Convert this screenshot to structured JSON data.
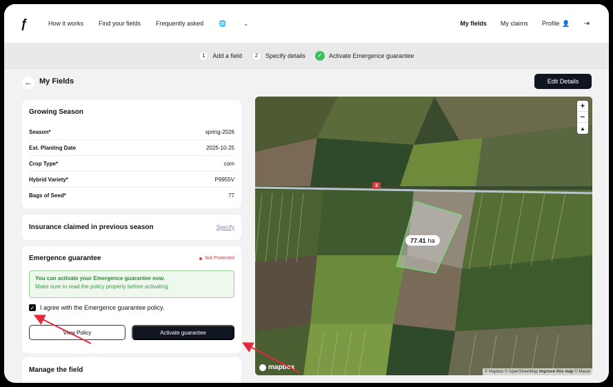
{
  "nav": {
    "logo": "ƒ",
    "links": [
      "How it works",
      "Find your fields",
      "Frequently asked"
    ],
    "language_icon": "globe-icon",
    "right_links": [
      "My fields",
      "My claims",
      "Profile"
    ],
    "active": "My fields"
  },
  "stepper": {
    "steps": [
      {
        "num": "1",
        "label": "Add a field",
        "state": "done"
      },
      {
        "num": "2",
        "label": "Specify details",
        "state": "done"
      },
      {
        "num": "",
        "label": "Activate Emergence guarantee",
        "state": "current"
      }
    ]
  },
  "page": {
    "title": "My Fields",
    "edit_button": "Edit Details"
  },
  "growing_season": {
    "title": "Growing Season",
    "rows": [
      {
        "key": "Season*",
        "value": "spring-2026"
      },
      {
        "key": "Est. Planting Date",
        "value": "2025-10-25"
      },
      {
        "key": "Crop Type*",
        "value": "corn"
      },
      {
        "key": "Hybrid Variety*",
        "value": "P9955V"
      },
      {
        "key": "Bags of Seed*",
        "value": "77"
      }
    ]
  },
  "insurance": {
    "title": "Insurance claimed in previous season",
    "link": "Specify"
  },
  "emergence": {
    "title": "Emergence guarantee",
    "status": "Not Protected",
    "status_color": "#d63a3a",
    "notice_title": "You can activate your Emergence guarantee now.",
    "notice_text": "Make sure to read the policy properly before activating.",
    "agree_label": "I agree with the Emergence guarantee policy.",
    "agree_checked": true,
    "view_policy": "View Policy",
    "activate": "Activate guarantee"
  },
  "manage": {
    "title": "Manage the field"
  },
  "map": {
    "area_value": "77.41",
    "area_unit": "ha",
    "road_number": "3",
    "zoom_in": "+",
    "zoom_out": "−",
    "compass": "▲",
    "logo_text": "mapbox",
    "attribution": "© Mapbox © OpenStreetMap",
    "improve": "Improve this map",
    "attribution_tail": "© Maxar"
  },
  "colors": {
    "accent_dark": "#111522",
    "success": "#3fc060",
    "annotation_arrow": "#e8283c"
  }
}
